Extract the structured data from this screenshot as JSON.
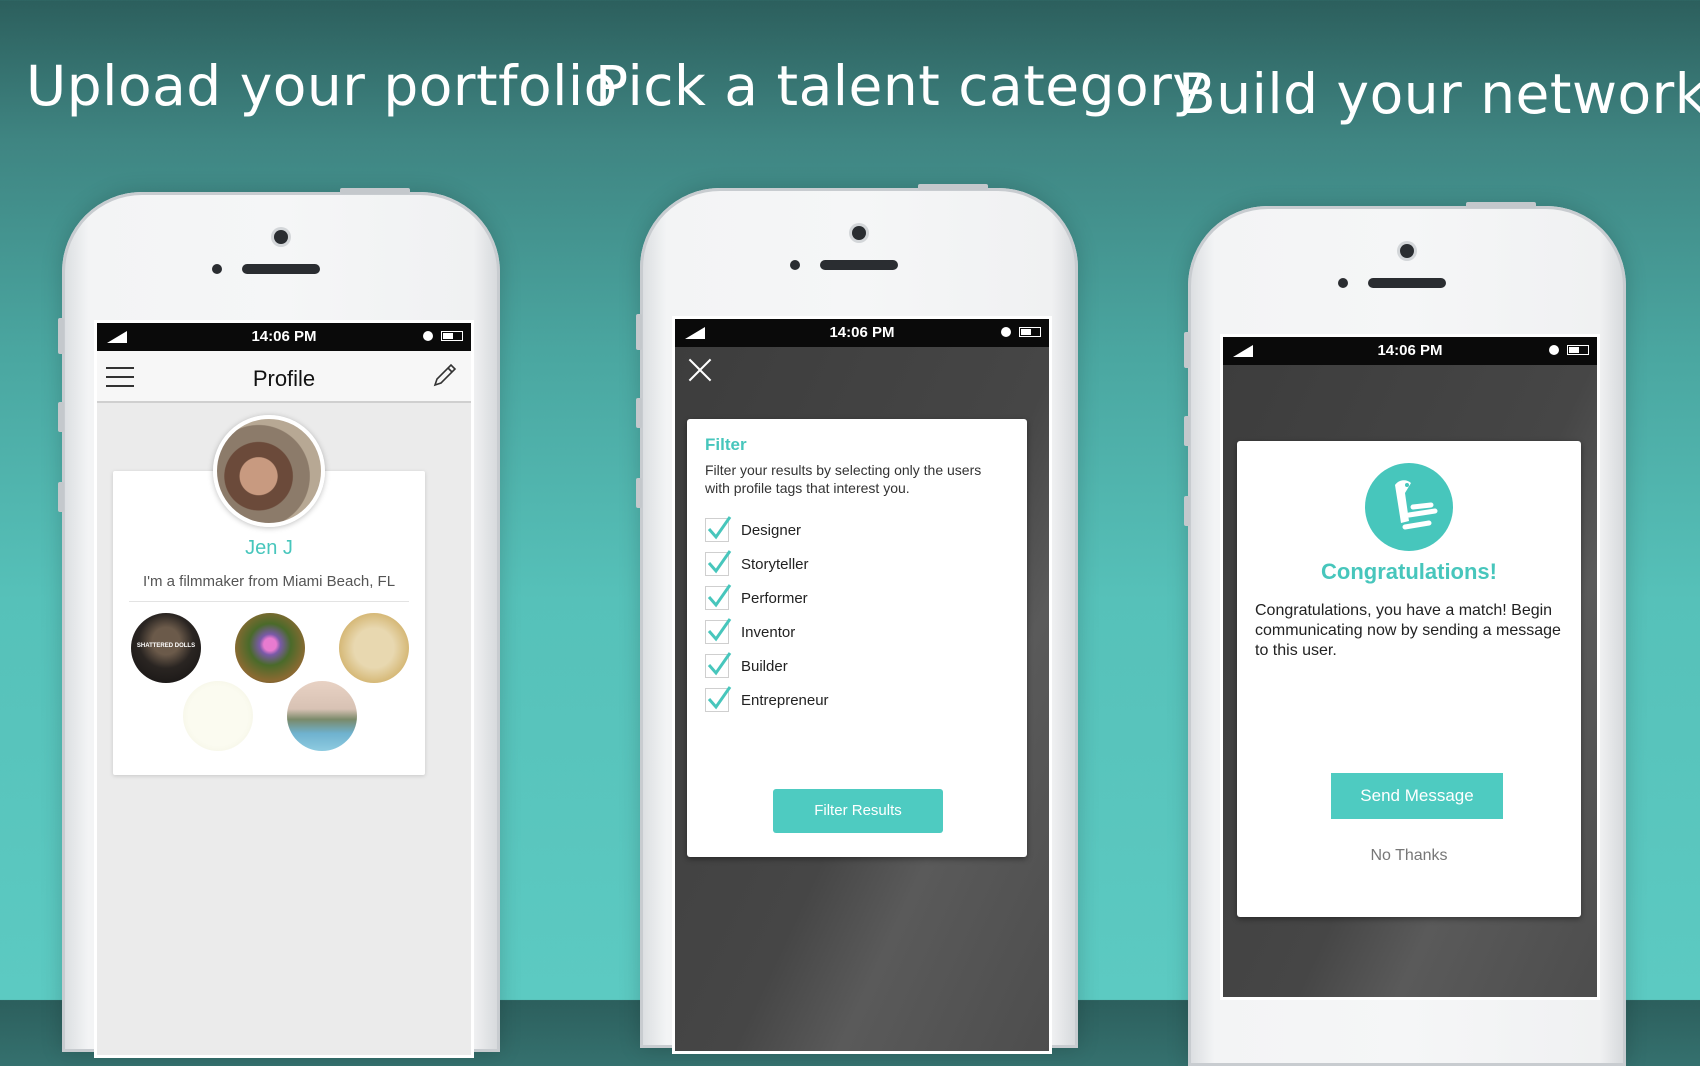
{
  "headlines": [
    "Upload your portfolio",
    "Pick a talent category",
    "Build your network"
  ],
  "status_time": "14:06 PM",
  "profile": {
    "title": "Profile",
    "name": "Jen J",
    "bio": "I'm a filmmaker from Miami Beach, FL",
    "portfolio_caption": "SHATTERED DOLLS"
  },
  "filter": {
    "title": "Filter",
    "description": "Filter your results by selecting only the users with profile tags that interest you.",
    "options": [
      "Designer",
      "Storyteller",
      "Performer",
      "Inventor",
      "Builder",
      "Entrepreneur"
    ],
    "button": "Filter Results"
  },
  "match": {
    "title": "Congratulations!",
    "body": "Congratulations, you have a match! Begin communicating now by sending a message to this user.",
    "send_button": "Send Message",
    "dismiss": "No Thanks"
  },
  "colors": {
    "accent": "#47c6bc",
    "button": "#4ecbc1"
  }
}
